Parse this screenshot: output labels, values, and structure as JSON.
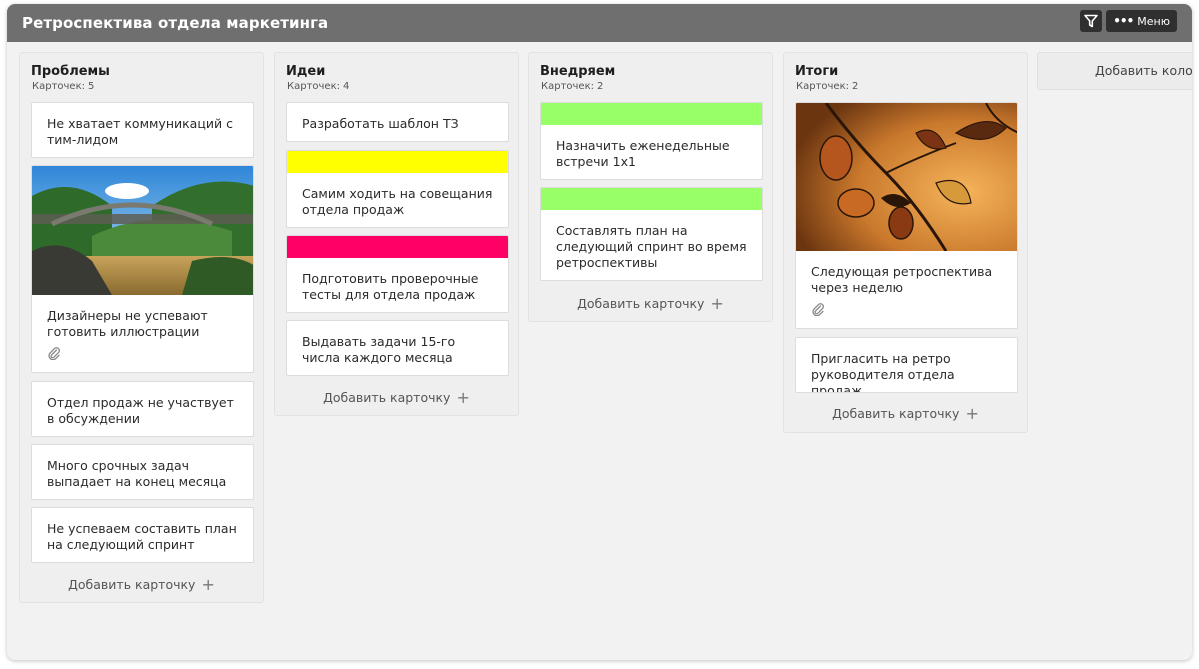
{
  "board": {
    "title": "Ретроспектива отдела маркетинга",
    "menu_label": "Меню"
  },
  "colors": {
    "header_bg": "#6f6f6f",
    "stripe_yellow": "#ffff00",
    "stripe_pink": "#ff0066",
    "stripe_green": "#99ff66"
  },
  "icons": [
    "filter-icon",
    "dots-icon",
    "paperclip-icon",
    "plus-icon"
  ],
  "count_label": "Карточек:",
  "add_card_label": "Добавить карточку",
  "add_column_label": "Добавить колон",
  "columns": [
    {
      "title": "Проблемы",
      "count": "5",
      "cards": [
        {
          "text": "Не хватает коммуникаций с тим-лидом"
        },
        {
          "text": "Дизайнеры не успевают готовить иллюстрации",
          "image": "bridge-over-river",
          "attachment": true
        },
        {
          "text": "Отдел продаж не участвует в обсуждении"
        },
        {
          "text": "Много срочных задач выпадает на конец месяца"
        },
        {
          "text": "Не успеваем составить план на следующий спринт"
        }
      ]
    },
    {
      "title": "Идеи",
      "count": "4",
      "cards": [
        {
          "text": "Разработать шаблон ТЗ"
        },
        {
          "text": "Самим ходить на совещания отдела продаж",
          "stripe": "yellow"
        },
        {
          "text": "Подготовить проверочные тесты для отдела продаж",
          "stripe": "pink"
        },
        {
          "text": "Выдавать задачи 15-го числа каждого месяца"
        }
      ]
    },
    {
      "title": "Внедряем",
      "count": "2",
      "cards": [
        {
          "text": "Назначить еженедельные встречи 1x1",
          "stripe": "green"
        },
        {
          "text": "Составлять план на следующий спринт во время ретроспективы",
          "stripe": "green"
        }
      ]
    },
    {
      "title": "Итоги",
      "count": "2",
      "cards": [
        {
          "text": "Следующая ретроспектива через неделю",
          "image": "autumn-persimmon-branch",
          "attachment": true
        },
        {
          "text": "Пригласить на ретро руководителя отдела продаж"
        }
      ]
    }
  ]
}
